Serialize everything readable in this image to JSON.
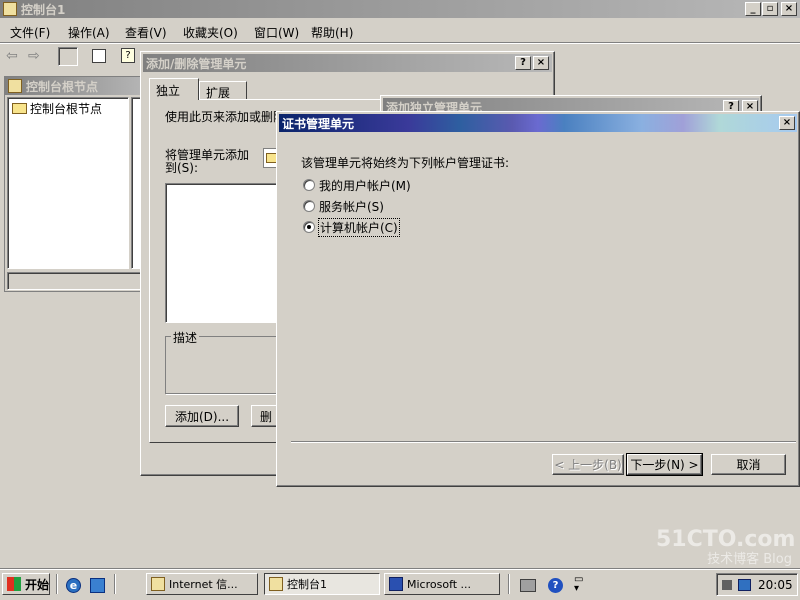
{
  "main_window": {
    "title": "控制台1",
    "menu": [
      "文件(F)",
      "操作(A)",
      "查看(V)",
      "收藏夹(O)",
      "窗口(W)",
      "帮助(H)"
    ],
    "tree_header": "控制台根节点",
    "tree_item": "控制台根节点"
  },
  "add_remove_dialog": {
    "title": "添加/删除管理单元",
    "tabs": [
      "独立",
      "扩展"
    ],
    "intro_text": "使用此页来添加或删除",
    "add_to_label": "将管理单元添加到(S):",
    "description_label": "描述",
    "add_button": "添加(D)...",
    "remove_button": "删"
  },
  "standalone_dialog": {
    "title": "添加独立管理单元"
  },
  "cert_dialog": {
    "title": "证书管理单元",
    "prompt": "该管理单元将始终为下列帐户管理证书:",
    "options": [
      {
        "label": "我的用户帐户(M)",
        "checked": false
      },
      {
        "label": "服务帐户(S)",
        "checked": false
      },
      {
        "label": "计算机帐户(C)",
        "checked": true
      }
    ],
    "back_button": "< 上一步(B)",
    "next_button": "下一步(N) >",
    "cancel_button": "取消"
  },
  "taskbar": {
    "start_label": "开始",
    "tasks": [
      "Internet 信...",
      "控制台1",
      "Microsoft ..."
    ],
    "clock": "20:05"
  },
  "watermark": {
    "site": "51CTO.com",
    "sub": "技术博客 Blog"
  },
  "colors": {
    "face": "#d4d0c8",
    "desktop": "#808080",
    "active_title_start": "#0a246a",
    "active_title_end": "#a6caf0"
  }
}
